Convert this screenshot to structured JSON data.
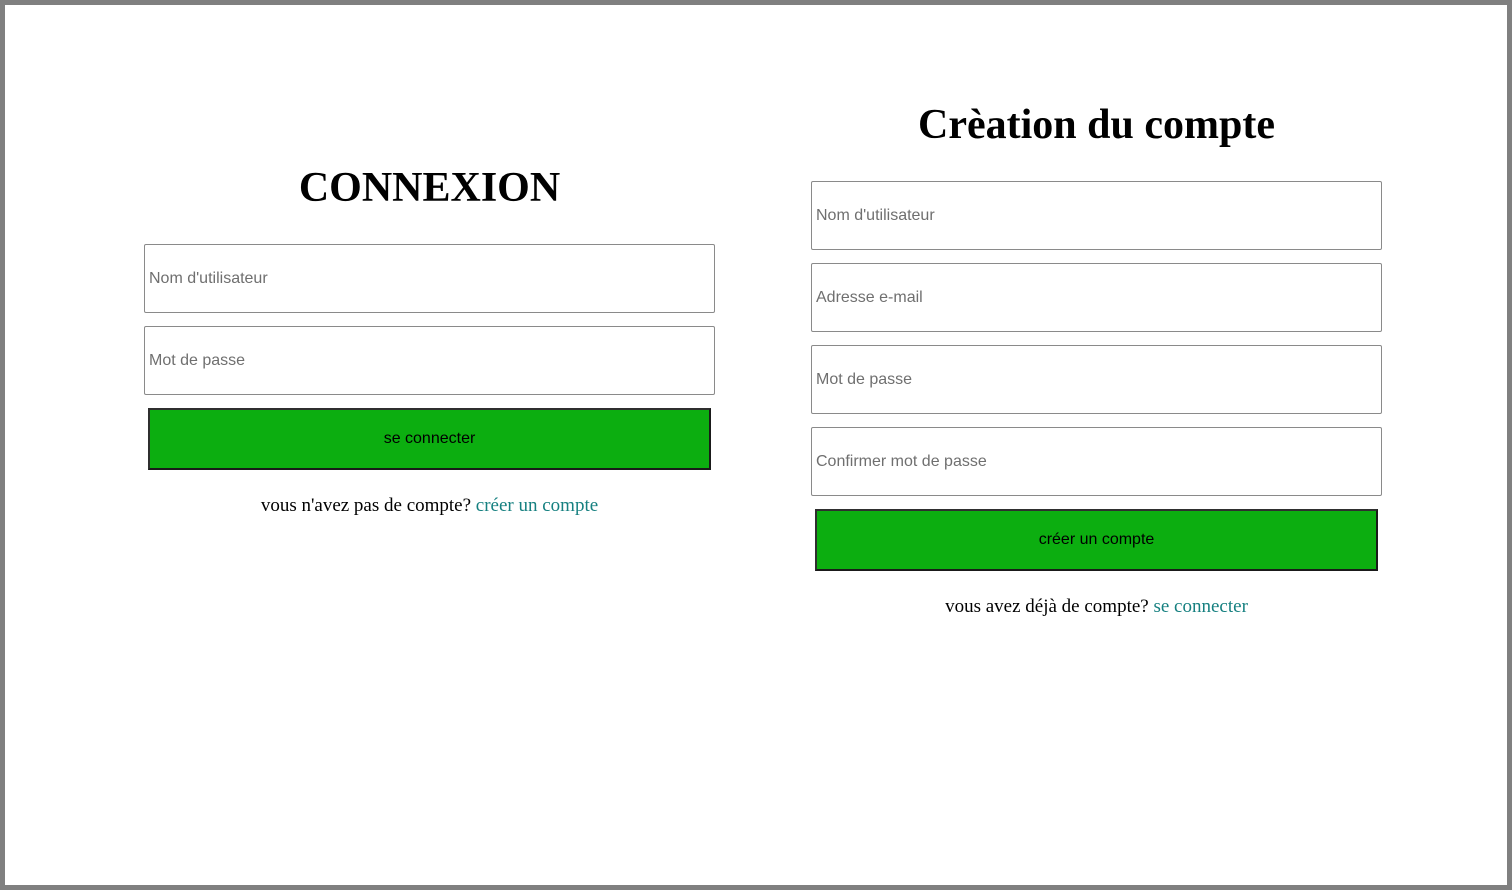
{
  "login": {
    "title": "CONNEXION",
    "username_placeholder": "Nom d'utilisateur",
    "password_placeholder": "Mot de passe",
    "submit_label": "se connecter",
    "footer_text": "vous n'avez pas de compte?",
    "footer_link": "créer un compte"
  },
  "signup": {
    "title": "Crèation du compte",
    "username_placeholder": "Nom d'utilisateur",
    "email_placeholder": "Adresse e-mail",
    "password_placeholder": "Mot de passe",
    "confirm_password_placeholder": "Confirmer mot de passe",
    "submit_label": "créer un compte",
    "footer_text": "vous avez déjà de compte?",
    "footer_link": "se connecter"
  },
  "colors": {
    "button_green": "#0cae10",
    "link_teal": "#168080",
    "frame_border": "#808080"
  }
}
